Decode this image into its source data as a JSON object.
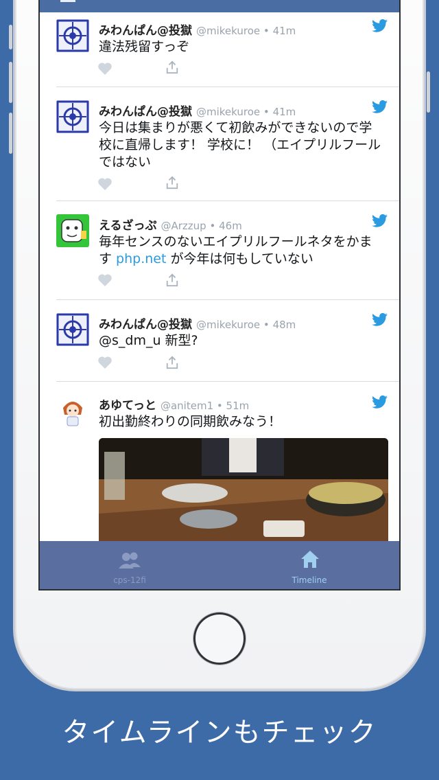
{
  "tweets": [
    {
      "name": "みわんぱん@投獄",
      "handle": "@mikekuroe",
      "time": "41m",
      "text": "違法残留すっぞ"
    },
    {
      "name": "みわんぱん@投獄",
      "handle": "@mikekuroe",
      "time": "41m",
      "text_lines": [
        "今日は集まりが悪くて初飲みができないので学",
        "校に直帰します！ 学校に！ （エイプリルフール",
        "ではない"
      ]
    },
    {
      "name": "えるざっぷ",
      "handle": "@Arzzup",
      "time": "46m",
      "text_line1": "毎年センスのないエイプリルフールネタをかま",
      "text_pre": "す ",
      "link": "php.net",
      "text_post": " が今年は何もしていない"
    },
    {
      "name": "みわんぱん@投獄",
      "handle": "@mikekuroe",
      "time": "48m",
      "text": "@s_dm_u 新型?"
    },
    {
      "name": "あゆてっと",
      "handle": "@anitem1",
      "time": "51m",
      "text": "初出勤終わりの同期飲みなう！"
    }
  ],
  "meta_sep": "•",
  "tabbar": {
    "tab1": "cps-12fi",
    "tab2": "Timeline"
  },
  "caption": "タイムラインもチェック",
  "colors": {
    "background": "#3d6ba7",
    "link": "#2a9be0",
    "tabbar": "#5a6fa0",
    "active_tab": "#9fd0f0"
  },
  "icons": [
    "twitter-bird-icon",
    "like-heart-icon",
    "share-icon",
    "users-icon",
    "home-icon"
  ]
}
